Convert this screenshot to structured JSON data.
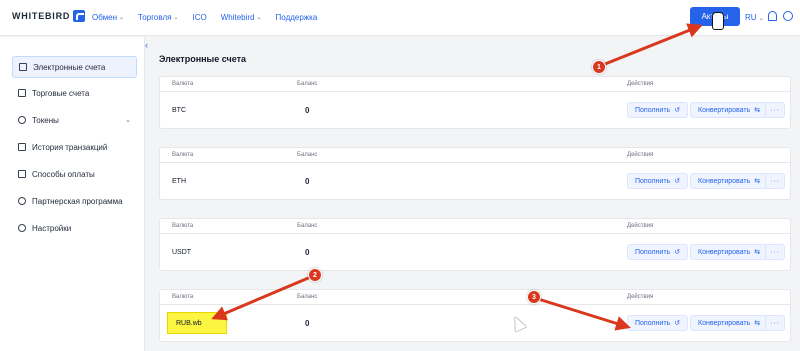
{
  "app": {
    "logo_text": "WHITEBIRD"
  },
  "topnav": {
    "items": [
      {
        "label": "Обмен",
        "has_dropdown": true
      },
      {
        "label": "Торговля",
        "has_dropdown": true
      },
      {
        "label": "ICO",
        "has_dropdown": false
      },
      {
        "label": "Whitebird",
        "has_dropdown": true
      },
      {
        "label": "Поддержка",
        "has_dropdown": false
      }
    ],
    "assets_button": "Активы",
    "language": "RU"
  },
  "sidebar": {
    "items": [
      {
        "label": "Электронные счета",
        "icon": "wallet-icon",
        "active": true
      },
      {
        "label": "Торговые счета",
        "icon": "chart-icon",
        "active": false
      },
      {
        "label": "Токены",
        "icon": "tokens-icon",
        "active": false,
        "has_dropdown": true
      },
      {
        "label": "История транзакций",
        "icon": "history-icon",
        "active": false
      },
      {
        "label": "Способы оплаты",
        "icon": "payment-icon",
        "active": false
      },
      {
        "label": "Партнерская программа",
        "icon": "partner-icon",
        "active": false
      },
      {
        "label": "Настройки",
        "icon": "gear-icon",
        "active": false
      }
    ]
  },
  "main": {
    "title": "Электронные счета",
    "columns": {
      "currency": "Валюта",
      "balance": "Баланс",
      "actions": "Действия"
    },
    "accounts": [
      {
        "currency": "BTC",
        "balance": "0",
        "deposit": "Пополнить",
        "convert": "Конвертировать",
        "more": "···"
      },
      {
        "currency": "ETH",
        "balance": "0",
        "deposit": "Пополнить",
        "convert": "Конвертировать",
        "more": "···"
      },
      {
        "currency": "USDT",
        "balance": "0",
        "deposit": "Пополнить",
        "convert": "Конвертировать",
        "more": "···"
      },
      {
        "currency": "RUB.wb",
        "balance": "0",
        "deposit": "Пополнить",
        "convert": "Конвертировать",
        "more": "···"
      }
    ]
  },
  "annotations": [
    {
      "number": "1"
    },
    {
      "number": "2"
    },
    {
      "number": "3"
    }
  ],
  "colors": {
    "accent": "#2563eb",
    "annotation": "#d9381e",
    "highlight": "#fcf542"
  }
}
